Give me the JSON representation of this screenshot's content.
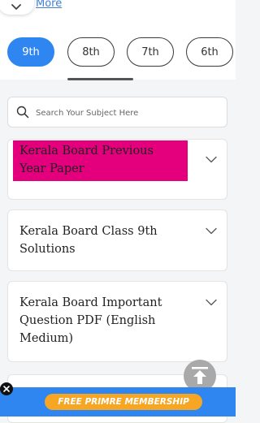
{
  "header": {
    "more_link": "More"
  },
  "class_tabs": [
    {
      "label": "9th",
      "active": true
    },
    {
      "label": "8th",
      "active": false
    },
    {
      "label": "7th",
      "active": false
    },
    {
      "label": "6th",
      "active": false
    }
  ],
  "search": {
    "placeholder": "Search Your Subject Here",
    "value": ""
  },
  "subjects": [
    {
      "title": "Kerala Board Previous Year Paper",
      "highlighted": true
    },
    {
      "title": "Kerala Board Class 9th Solutions",
      "highlighted": false
    },
    {
      "title": "Kerala Board Important Question PDF (English Medium)",
      "highlighted": false
    }
  ],
  "membership": {
    "label": "FREE PRIMRE MEMBERSHIP"
  },
  "colors": {
    "accent": "#2f86f0",
    "highlight": "#e4007c",
    "membership_button": "#f6a623"
  }
}
